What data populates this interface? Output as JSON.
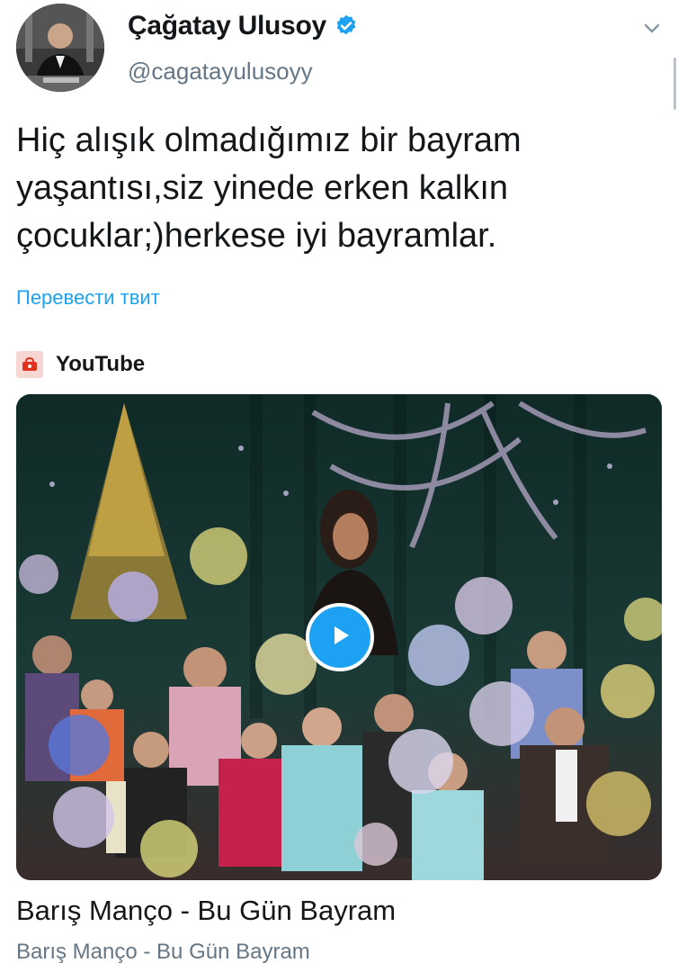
{
  "tweet": {
    "author": {
      "display_name": "Çağatay Ulusoy",
      "handle": "@cagatayulusoyy",
      "verified": true
    },
    "text": "Hiç alışık olmadığımız bir bayram\nyaşantısı,siz yinede erken kalkın\nçocuklar;)herkese iyi bayramlar.",
    "translate_label": "Перевести твит"
  },
  "card": {
    "source": "YouTube",
    "title": "Barış Manço - Bu Gün Bayram",
    "description": "Barış Manço - Bu Gün Bayram"
  },
  "colors": {
    "accent": "#1da1f2",
    "text_primary": "#14171a",
    "text_secondary": "#657786",
    "youtube_red": "#e0301e"
  },
  "icons": {
    "verified": "verified-badge-icon",
    "menu": "chevron-down-icon",
    "source": "youtube-icon",
    "play": "play-icon"
  }
}
